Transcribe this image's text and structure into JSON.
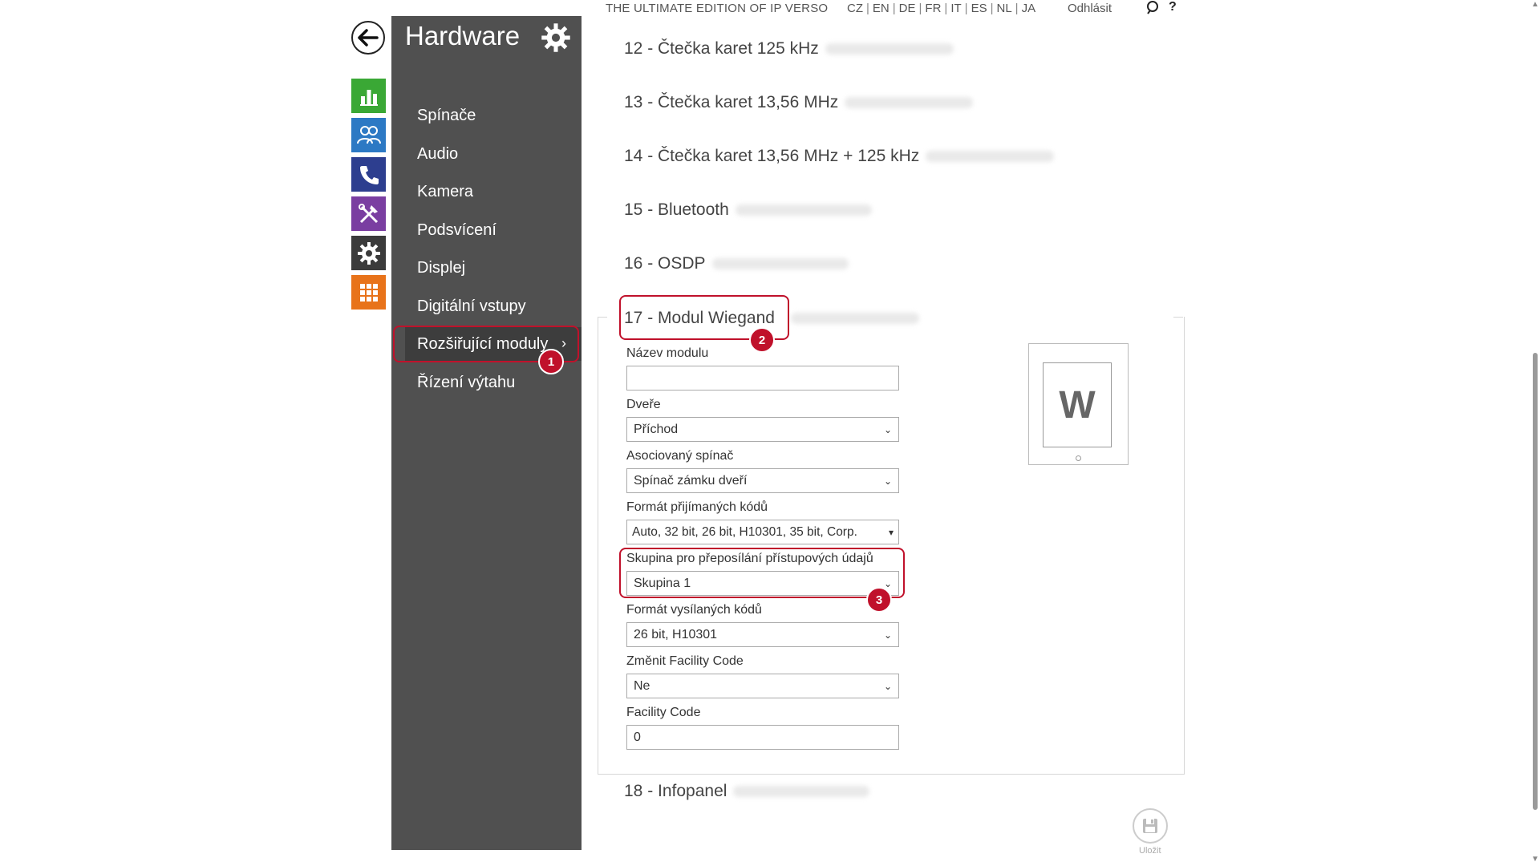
{
  "topbar": {
    "edition": "THE ULTIMATE EDITION OF IP VERSO",
    "languages": [
      "CZ",
      "EN",
      "DE",
      "FR",
      "IT",
      "ES",
      "NL",
      "JA"
    ],
    "logout": "Odhlásit",
    "help": "?"
  },
  "app_icons": [
    {
      "name": "status-icon",
      "color": "#3aa835"
    },
    {
      "name": "directory-icon",
      "color": "#2c79c4"
    },
    {
      "name": "phone-icon",
      "color": "#2d3e8f"
    },
    {
      "name": "services-icon",
      "color": "#7a3ea1"
    },
    {
      "name": "hardware-icon",
      "color": "#3b3b3b"
    },
    {
      "name": "system-icon",
      "color": "#e8731a"
    }
  ],
  "sidebar": {
    "title": "Hardware",
    "items": [
      {
        "label": "Spínače"
      },
      {
        "label": "Audio"
      },
      {
        "label": "Kamera"
      },
      {
        "label": "Podsvícení"
      },
      {
        "label": "Displej"
      },
      {
        "label": "Digitální vstupy"
      },
      {
        "label": "Rozšiřující moduly",
        "active": true
      },
      {
        "label": "Řízení výtahu"
      }
    ]
  },
  "modules": [
    {
      "label": "12 - Čtečka karet 125 kHz"
    },
    {
      "label": "13 - Čtečka karet 13,56 MHz"
    },
    {
      "label": "14 - Čtečka karet 13,56 MHz + 125 kHz"
    },
    {
      "label": "15 - Bluetooth"
    },
    {
      "label": "16 - OSDP"
    },
    {
      "label": "17 - Modul Wiegand"
    },
    {
      "label": "18 - Infopanel"
    }
  ],
  "form": {
    "module_name": {
      "label": "Název modulu",
      "value": ""
    },
    "door": {
      "label": "Dveře",
      "value": "Příchod"
    },
    "switch": {
      "label": "Asociovaný spínač",
      "value": "Spínač zámku dveří"
    },
    "rx_format": {
      "label": "Formát přijímaných kódů",
      "value": "Auto, 32 bit, 26 bit, H10301, 35 bit, Corp."
    },
    "forward_group": {
      "label": "Skupina pro přeposílání přístupových údajů",
      "value": "Skupina 1"
    },
    "tx_format": {
      "label": "Formát vysílaných kódů",
      "value": "26 bit, H10301"
    },
    "change_fc": {
      "label": "Změnit Facility Code",
      "value": "Ne"
    },
    "facility_code": {
      "label": "Facility Code",
      "value": "0"
    }
  },
  "thumbnail": {
    "letter": "W"
  },
  "badges": {
    "one": "1",
    "two": "2",
    "three": "3"
  },
  "save": {
    "label": "Uložit"
  },
  "colors": {
    "highlight": "#c0112b",
    "sidebar": "#505050"
  }
}
